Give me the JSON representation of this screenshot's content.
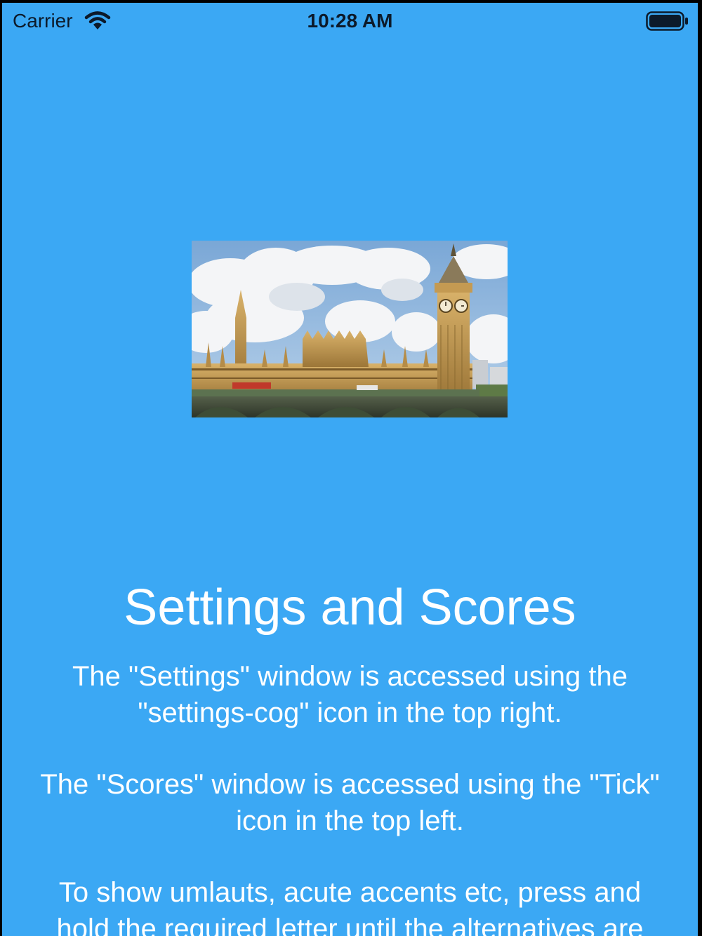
{
  "status_bar": {
    "carrier": "Carrier",
    "time": "10:28 AM",
    "icons": [
      "wifi-icon",
      "battery-icon"
    ]
  },
  "main": {
    "image_name": "houses-of-parliament-photo",
    "title": "Settings and Scores",
    "paragraphs": [
      "The \"Settings\" window is accessed using the\n\"settings-cog\" icon in the top right.",
      "The \"Scores\" window is accessed using the \"Tick\"\nicon in the top left.",
      "To show umlauts, acute accents etc, press and\nhold the required letter until the alternatives are"
    ]
  },
  "colors": {
    "background": "#3ba8f4",
    "text": "#ffffff",
    "status_text": "#0c1a2a"
  }
}
